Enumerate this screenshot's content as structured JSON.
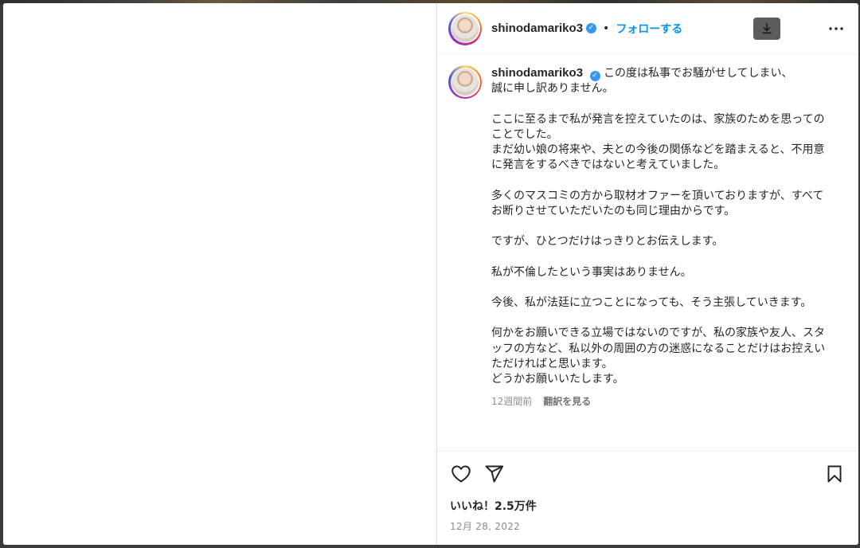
{
  "post": {
    "username": "shinodamariko3",
    "verified_mark": "✓",
    "separator": "•",
    "follow_label": "フォローする",
    "more_label": "•••",
    "caption": "この度は私事でお騒がせしてしまい、\n誠に申し訳ありません。\n\nここに至るまで私が発言を控えていたのは、家族のためを思ってのことでした。\nまだ幼い娘の将来や、夫との今後の関係などを踏まえると、不用意に発言をするべきではないと考えていました。\n\n多くのマスコミの方から取材オファーを頂いておりますが、すべてお断りさせていただいたのも同じ理由からです。\n\nですが、ひとつだけはっきりとお伝えします。\n\n私が不倫したという事実はありません。\n\n今後、私が法廷に立つことになっても、そう主張していきます。\n\n何かをお願いできる立場ではないのですが、私の家族や友人、スタッフの方など、私以外の周囲の方の迷惑になることだけはお控えいただければと思います。\nどうかお願いいたします。",
    "time_ago": "12週間前",
    "translate_label": "翻訳を見る",
    "likes": "いいね！2.5万件",
    "date": "12月 28, 2022"
  },
  "icons": {
    "avatar": "profile-photo",
    "verified": "verified-badge-icon",
    "download": "download-icon",
    "more": "more-options-icon",
    "like": "heart-icon",
    "share": "paper-plane-icon",
    "save": "bookmark-icon"
  },
  "colors": {
    "link": "#0095f6",
    "verified": "#3897f0",
    "text": "#262626",
    "secondary": "#8e8e8e"
  }
}
